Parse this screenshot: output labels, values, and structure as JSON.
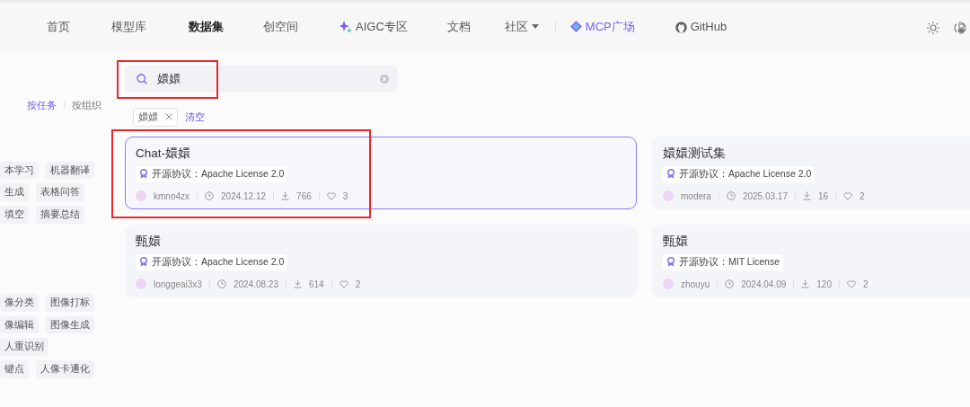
{
  "nav": {
    "items": [
      {
        "label": "首页",
        "kind": "plain",
        "selected": false
      },
      {
        "label": "模型库",
        "kind": "plain",
        "selected": false
      },
      {
        "label": "数据集",
        "kind": "plain",
        "selected": true
      },
      {
        "label": "创空间",
        "kind": "plain",
        "selected": false
      },
      {
        "label": "AIGC专区",
        "kind": "sparkle",
        "selected": false
      },
      {
        "label": "文档",
        "kind": "plain",
        "selected": false
      },
      {
        "label": "社区",
        "kind": "dropdown",
        "selected": false
      },
      {
        "label": "MCP广场",
        "kind": "mcp",
        "selected": false
      },
      {
        "label": "GitHub",
        "kind": "github",
        "selected": false
      }
    ]
  },
  "sidebar": {
    "modes": [
      {
        "label": "按任务",
        "selected": true
      },
      {
        "label": "按组织",
        "selected": false
      }
    ],
    "tag_groups": [
      [
        [
          "本学习",
          "机器翻译"
        ],
        [
          "生成",
          "表格问答"
        ],
        [
          "填空",
          "摘要总结"
        ]
      ],
      [
        [
          "像分类",
          "图像打标"
        ],
        [
          "像编辑",
          "图像生成"
        ],
        [
          "人重识别"
        ],
        [
          "键点",
          "人像卡通化"
        ]
      ]
    ]
  },
  "search": {
    "value": "嬛嬛",
    "highlighted": true
  },
  "filters": [
    {
      "label": "嬛嬛"
    }
  ],
  "clear_label": "清空",
  "datasets": [
    {
      "title": "Chat-嬛嬛",
      "license": "开源协议：Apache License 2.0",
      "user": "kmno4zx",
      "date": "2024.12.12",
      "downloads": "766",
      "likes": "3",
      "selected": true,
      "highlighted": true
    },
    {
      "title": "嬛嬛测试集",
      "license": "开源协议：Apache License 2.0",
      "user": "modera",
      "date": "2025.03.17",
      "downloads": "16",
      "likes": "2",
      "selected": false,
      "highlighted": false
    },
    {
      "title": "甄嬛",
      "license": "开源协议：Apache License 2.0",
      "user": "longgeai3x3",
      "date": "2024.08.23",
      "downloads": "614",
      "likes": "2",
      "selected": false,
      "highlighted": false
    },
    {
      "title": "甄嬛",
      "license": "开源协议：MIT License",
      "user": "zhouyu",
      "date": "2024.04.09",
      "downloads": "120",
      "likes": "2",
      "selected": false,
      "highlighted": false
    }
  ]
}
